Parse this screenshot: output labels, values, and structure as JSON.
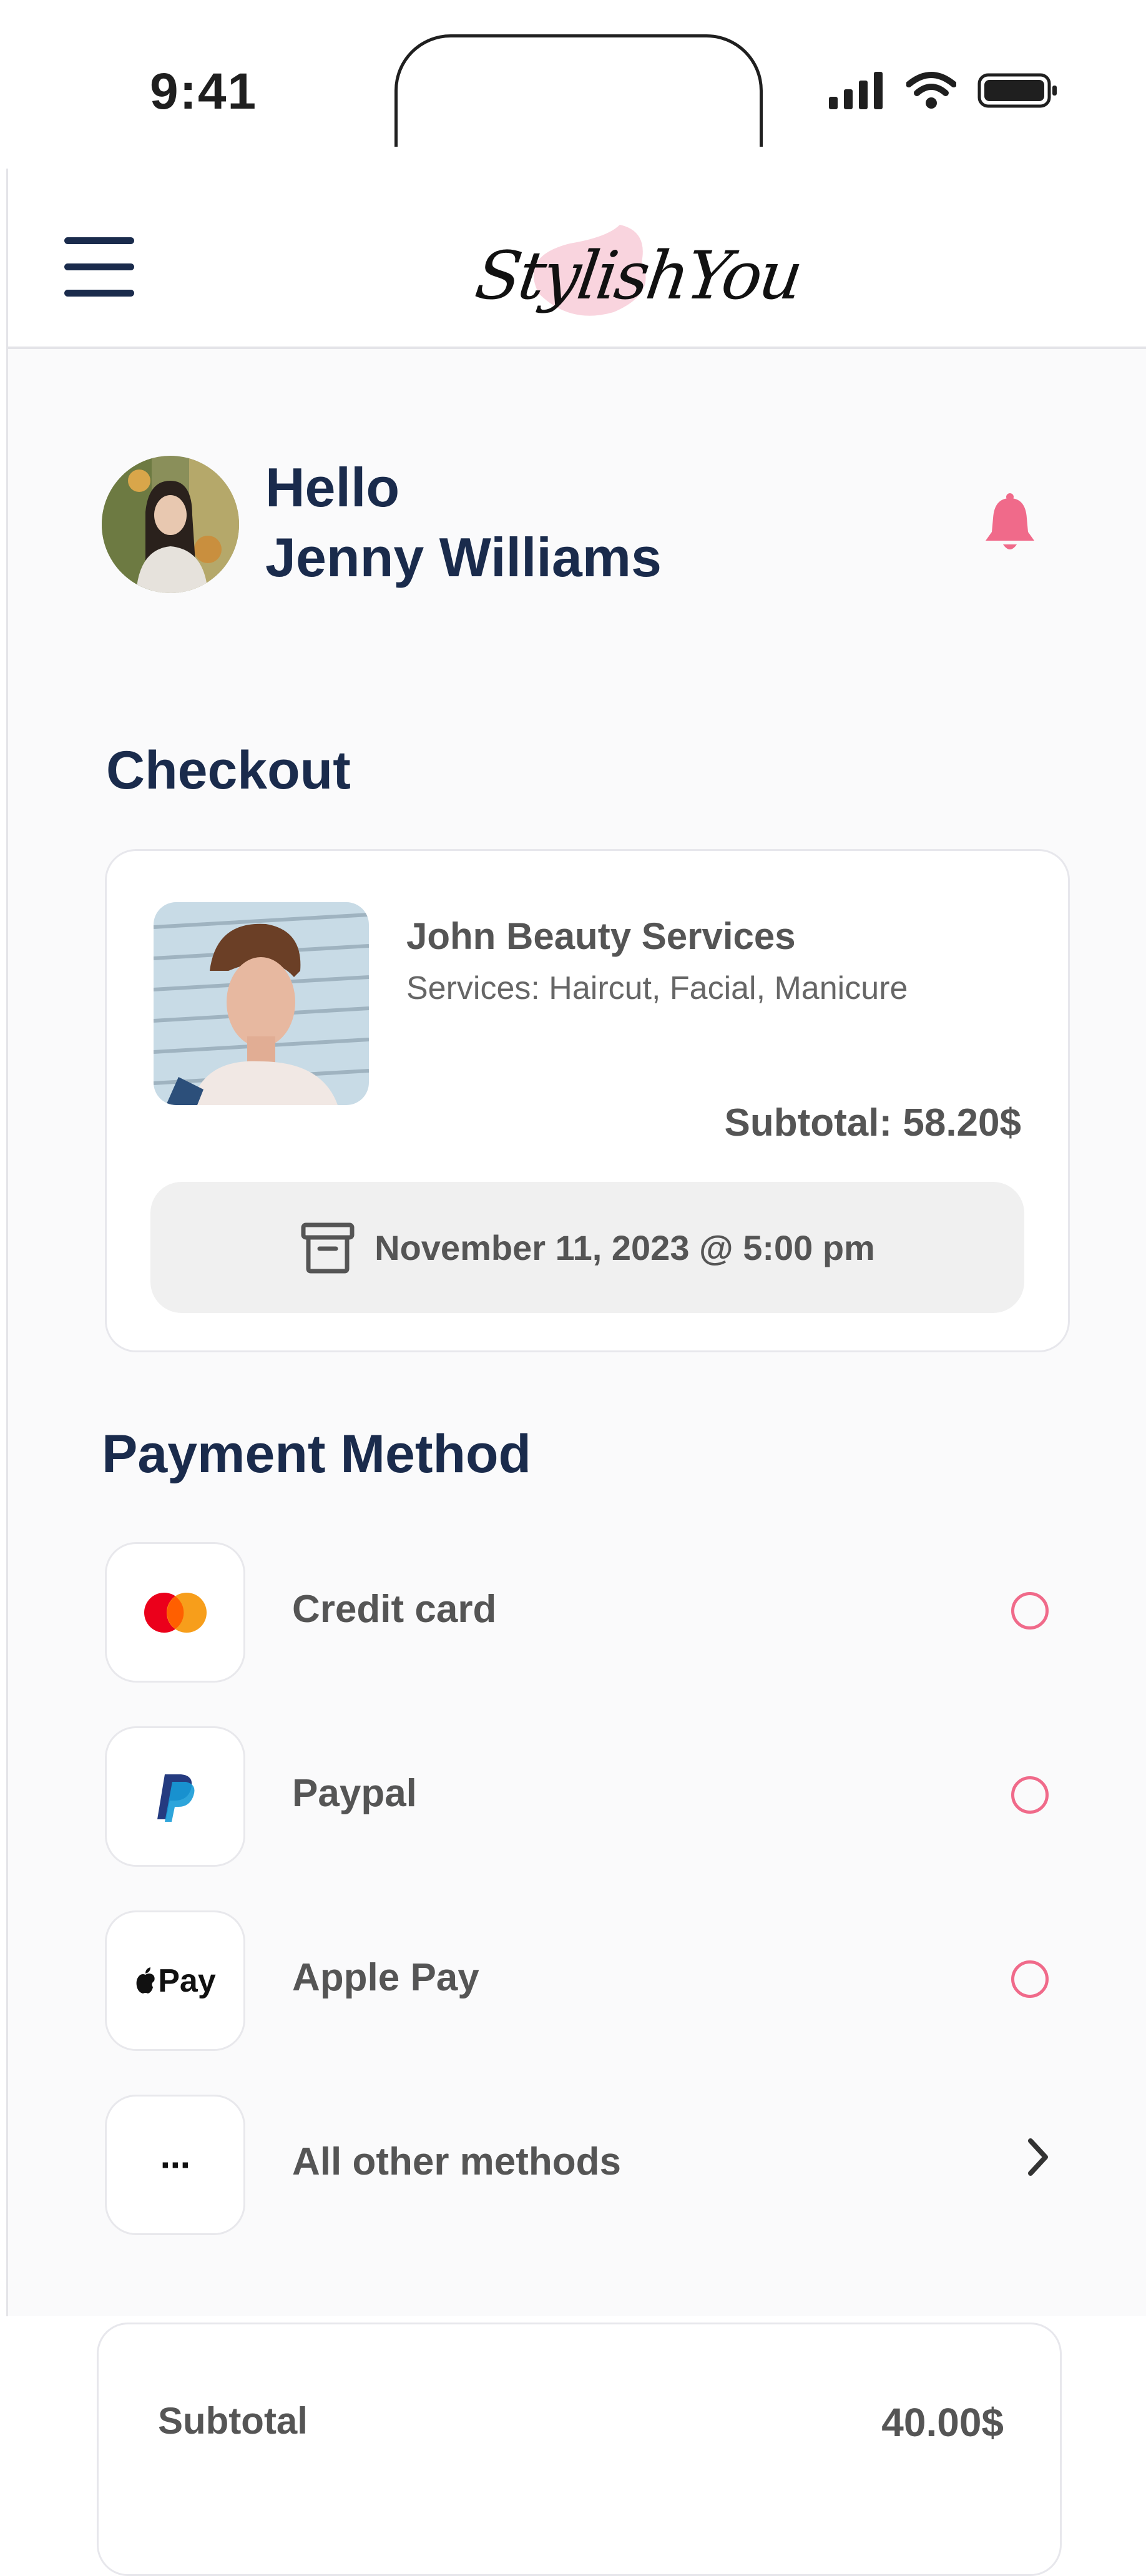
{
  "status_bar": {
    "time": "9:41"
  },
  "navbar": {
    "logo_text": "StylishYou"
  },
  "user": {
    "greeting": "Hello",
    "name": "Jenny Williams"
  },
  "checkout": {
    "title": "Checkout",
    "provider_name": "John Beauty Services",
    "services": "Services: Haircut, Facial, Manicure",
    "subtotal": "Subtotal: 58.20$",
    "appointment": "November 11, 2023 @ 5:00 pm"
  },
  "payment": {
    "title": "Payment Method",
    "methods": [
      {
        "label": "Credit card",
        "icon": "mastercard-icon"
      },
      {
        "label": "Paypal",
        "icon": "paypal-icon"
      },
      {
        "label": "Apple Pay",
        "icon": "apple-pay-icon",
        "icon_text": "Pay"
      },
      {
        "label": "All other methods",
        "icon": "more-dots-icon",
        "icon_text": "···"
      }
    ]
  },
  "summary": {
    "subtotal_label": "Subtotal",
    "subtotal_value": "40.00$"
  },
  "colors": {
    "accent": "#f06a8a",
    "primary": "#1a2b4c",
    "muted_text": "#555555"
  }
}
